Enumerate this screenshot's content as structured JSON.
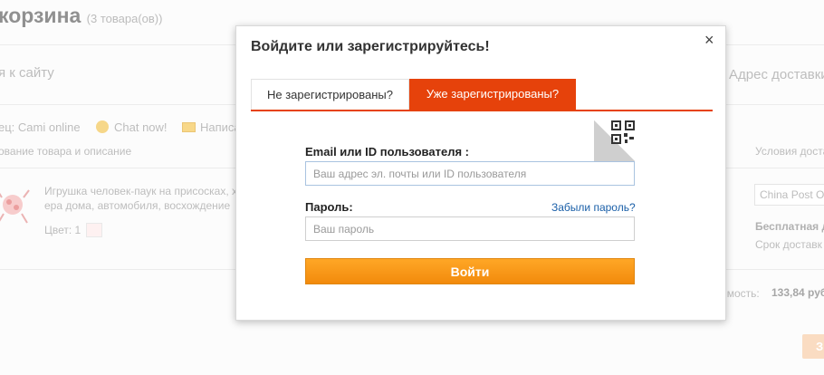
{
  "background": {
    "cart_title": "корзина",
    "cart_count": "(3 товара(ов))",
    "back_to_site": "я к сайту",
    "delivery_address": "Адрес доставки:",
    "seller_label": "ец:  Cami online",
    "chat_label": "Chat now!",
    "write_label": "Написа",
    "col_product": "ование товара и описание",
    "col_shipping": "Условия доста",
    "product_line1": "Игрушка человек-паук на присосках, х",
    "product_line2": "ера дома, автомобиля, восхождение",
    "color_label": "Цвет:  1",
    "shipping_select": "China Post O",
    "free_shipping": "Бесплатная д",
    "delivery_time": "Срок доставк",
    "sum_label": "имость:",
    "sum_value": "133,84 руб",
    "checkout_btn": "З"
  },
  "modal": {
    "title": "Войдите или зарегистрируйтесь!",
    "close": "×",
    "tabs": [
      {
        "label": "Не зарегистрированы?",
        "active": false
      },
      {
        "label": "Уже зарегистрированы?",
        "active": true
      }
    ],
    "email_label": "Email или ID пользователя :",
    "email_placeholder": "Ваш адрес эл. почты или ID пользователя",
    "password_label": "Пароль:",
    "forgot_link": "Забыли пароль?",
    "password_placeholder": "Ваш пароль",
    "login_button": "Войти"
  },
  "colors": {
    "accent": "#e6420b",
    "button": "#f7981c",
    "link": "#1a5fa8"
  }
}
